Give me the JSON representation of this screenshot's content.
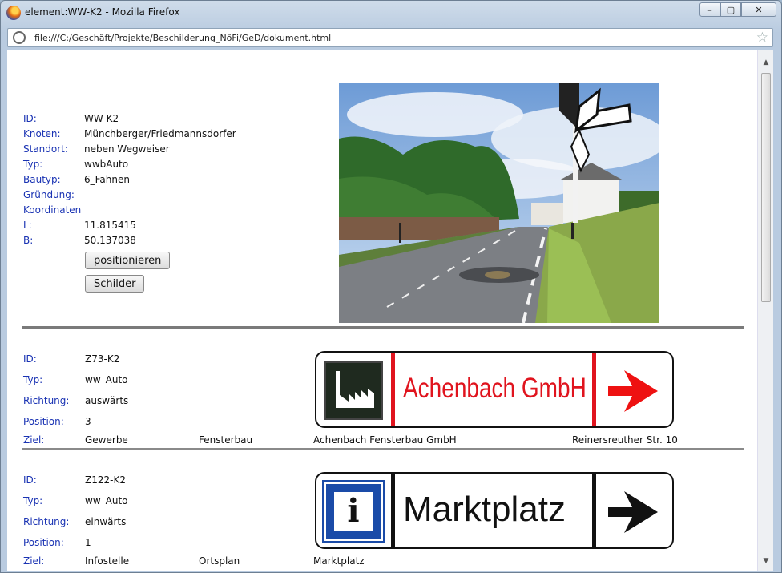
{
  "window": {
    "title": "element:WW-K2 - Mozilla Firefox",
    "url": "file:///C:/Geschäft/Projekte/Beschilderung_NöFi/GeD/dokument.html",
    "buttons": {
      "minimize": "–",
      "restore": "▢",
      "close": "✕"
    }
  },
  "element": {
    "fields": [
      {
        "label": "ID:",
        "value": "WW-K2"
      },
      {
        "label": "Knoten:",
        "value": "Münchberger/Friedmannsdorfer"
      },
      {
        "label": "Standort:",
        "value": "neben Wegweiser"
      },
      {
        "label": "Typ:",
        "value": "wwbAuto"
      },
      {
        "label": "Bautyp:",
        "value": "6_Fahnen"
      },
      {
        "label": "Gründung:",
        "value": ""
      },
      {
        "label": "Koordinaten",
        "value": ""
      },
      {
        "label": "L:",
        "value": "11.815415"
      },
      {
        "label": "B:",
        "value": "50.137038"
      }
    ],
    "buttons": {
      "position": "positionieren",
      "signs": "Schilder"
    }
  },
  "signs": [
    {
      "fields": [
        {
          "label": "ID:",
          "value": "Z73-K2"
        },
        {
          "label": "Typ:",
          "value": "ww_Auto"
        },
        {
          "label": "Richtung:",
          "value": "auswärts"
        },
        {
          "label": "Position:",
          "value": "3"
        }
      ],
      "ziel_label": "Ziel:",
      "ziel": [
        "Gewerbe",
        "Fensterbau",
        "Achenbach Fensterbau GmbH",
        "Reinersreuther Str. 10"
      ],
      "sign_text": "Achenbach GmbH",
      "text_color": "#e0141e",
      "arrow_color": "#ee1111",
      "icon": "factory-icon"
    },
    {
      "fields": [
        {
          "label": "ID:",
          "value": "Z122-K2"
        },
        {
          "label": "Typ:",
          "value": "ww_Auto"
        },
        {
          "label": "Richtung:",
          "value": "einwärts"
        },
        {
          "label": "Position:",
          "value": "1"
        }
      ],
      "ziel_label": "Ziel:",
      "ziel": [
        "Infostelle",
        "Ortsplan",
        "Marktplatz"
      ],
      "sign_text": "Marktplatz",
      "text_color": "#111111",
      "arrow_color": "#111111",
      "icon": "info-icon",
      "icon_letter": "i"
    }
  ]
}
